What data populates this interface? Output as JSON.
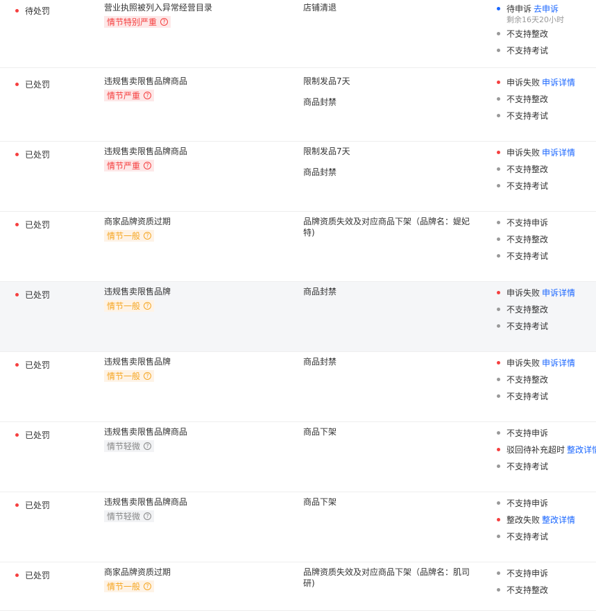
{
  "colors": {
    "red": "#f53f3f",
    "blue": "#1966ff",
    "gray": "#999999",
    "serious_bg": "#fde8e8",
    "serious_fg": "#f53f3f",
    "normal_bg": "#fef3e6",
    "normal_fg": "#f5a623",
    "minor_bg": "#f2f3f5",
    "minor_fg": "#888888"
  },
  "rows": [
    {
      "status": "待处罚",
      "reason": "营业执照被列入异常经营目录",
      "severity": "情节特别严重",
      "sev_level": "serious",
      "penalties": [
        "店铺清退"
      ],
      "statuses": [
        {
          "text": "待申诉",
          "link": "去申诉",
          "dot": "blue",
          "sub": "剩余16天20小时"
        },
        {
          "text": "不支持整改",
          "link": "",
          "dot": "gray",
          "sub": ""
        },
        {
          "text": "不支持考试",
          "link": "",
          "dot": "gray",
          "sub": ""
        }
      ]
    },
    {
      "status": "已处罚",
      "reason": "违规售卖限售品牌商品",
      "severity": "情节严重",
      "sev_level": "serious",
      "penalties": [
        "限制发品7天",
        "商品封禁"
      ],
      "statuses": [
        {
          "text": "申诉失败",
          "link": "申诉详情",
          "dot": "red",
          "sub": ""
        },
        {
          "text": "不支持整改",
          "link": "",
          "dot": "gray",
          "sub": ""
        },
        {
          "text": "不支持考试",
          "link": "",
          "dot": "gray",
          "sub": ""
        }
      ]
    },
    {
      "status": "已处罚",
      "reason": "违规售卖限售品牌商品",
      "severity": "情节严重",
      "sev_level": "serious",
      "penalties": [
        "限制发品7天",
        "商品封禁"
      ],
      "statuses": [
        {
          "text": "申诉失败",
          "link": "申诉详情",
          "dot": "red",
          "sub": ""
        },
        {
          "text": "不支持整改",
          "link": "",
          "dot": "gray",
          "sub": ""
        },
        {
          "text": "不支持考试",
          "link": "",
          "dot": "gray",
          "sub": ""
        }
      ]
    },
    {
      "status": "已处罚",
      "reason": "商家品牌资质过期",
      "severity": "情节一般",
      "sev_level": "normal",
      "penalties": [
        "品牌资质失效及对应商品下架（品牌名：媞妃特)"
      ],
      "statuses": [
        {
          "text": "不支持申诉",
          "link": "",
          "dot": "gray",
          "sub": ""
        },
        {
          "text": "不支持整改",
          "link": "",
          "dot": "gray",
          "sub": ""
        },
        {
          "text": "不支持考试",
          "link": "",
          "dot": "gray",
          "sub": ""
        }
      ]
    },
    {
      "status": "已处罚",
      "reason": "违规售卖限售品牌",
      "severity": "情节一般",
      "sev_level": "normal",
      "penalties": [
        "商品封禁"
      ],
      "statuses": [
        {
          "text": "申诉失败",
          "link": "申诉详情",
          "dot": "red",
          "sub": ""
        },
        {
          "text": "不支持整改",
          "link": "",
          "dot": "gray",
          "sub": ""
        },
        {
          "text": "不支持考试",
          "link": "",
          "dot": "gray",
          "sub": ""
        }
      ]
    },
    {
      "status": "已处罚",
      "reason": "违规售卖限售品牌",
      "severity": "情节一般",
      "sev_level": "normal",
      "penalties": [
        "商品封禁"
      ],
      "statuses": [
        {
          "text": "申诉失败",
          "link": "申诉详情",
          "dot": "red",
          "sub": ""
        },
        {
          "text": "不支持整改",
          "link": "",
          "dot": "gray",
          "sub": ""
        },
        {
          "text": "不支持考试",
          "link": "",
          "dot": "gray",
          "sub": ""
        }
      ]
    },
    {
      "status": "已处罚",
      "reason": "违规售卖限售品牌商品",
      "severity": "情节轻微",
      "sev_level": "minor",
      "penalties": [
        "商品下架"
      ],
      "statuses": [
        {
          "text": "不支持申诉",
          "link": "",
          "dot": "gray",
          "sub": ""
        },
        {
          "text": "驳回待补充超时",
          "link": "整改详情",
          "dot": "red",
          "sub": ""
        },
        {
          "text": "不支持考试",
          "link": "",
          "dot": "gray",
          "sub": ""
        }
      ]
    },
    {
      "status": "已处罚",
      "reason": "违规售卖限售品牌商品",
      "severity": "情节轻微",
      "sev_level": "minor",
      "penalties": [
        "商品下架"
      ],
      "statuses": [
        {
          "text": "不支持申诉",
          "link": "",
          "dot": "gray",
          "sub": ""
        },
        {
          "text": "整改失败",
          "link": "整改详情",
          "dot": "red",
          "sub": ""
        },
        {
          "text": "不支持考试",
          "link": "",
          "dot": "gray",
          "sub": ""
        }
      ]
    },
    {
      "status": "已处罚",
      "reason": "商家品牌资质过期",
      "severity": "情节一般",
      "sev_level": "normal",
      "penalties": [
        "品牌资质失效及对应商品下架（品牌名：肌司研)"
      ],
      "statuses": [
        {
          "text": "不支持申诉",
          "link": "",
          "dot": "gray",
          "sub": ""
        },
        {
          "text": "不支持整改",
          "link": "",
          "dot": "gray",
          "sub": ""
        }
      ]
    }
  ]
}
